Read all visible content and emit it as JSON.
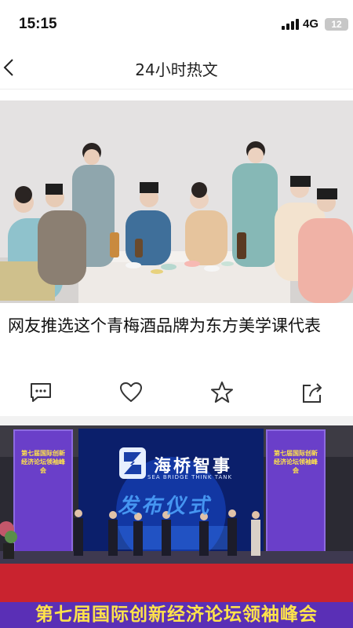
{
  "status_bar": {
    "time": "15:15",
    "network": "4G",
    "battery": "12"
  },
  "nav": {
    "title": "24小时热文",
    "back_icon": "chevron-left-icon"
  },
  "articles": [
    {
      "headline": "网友推选这个青梅酒品牌为东方美学课代表",
      "image": "photo of people in traditional Chinese costume at a banquet table",
      "actions": [
        {
          "name": "comment-icon"
        },
        {
          "name": "heart-icon"
        },
        {
          "name": "star-icon"
        },
        {
          "name": "share-icon"
        }
      ]
    },
    {
      "image_texts": {
        "logo": "海桥智事",
        "logo_sub": "SEA BRIDGE THINK TANK",
        "screen": "发布仪式",
        "panel_left": "第七届国际创新经济论坛领袖峰会",
        "panel_right": "第七届国际创新经济论坛领袖峰会",
        "banner": "第七届国际创新经济论坛领袖峰会"
      }
    }
  ],
  "colors": {
    "accent_text": "#222222",
    "divider": "#f2f2f2",
    "banner_purple": "#5a2fb6",
    "banner_text": "#ffe34a"
  }
}
